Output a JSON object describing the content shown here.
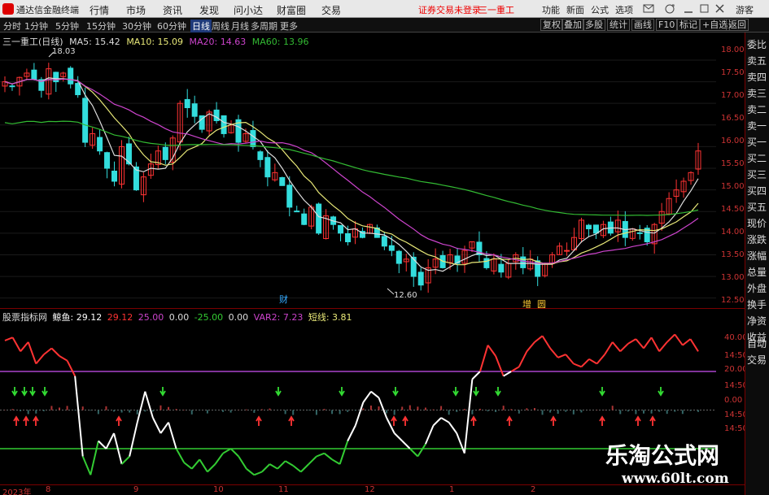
{
  "app": {
    "title": "通达信金融终端"
  },
  "menu": [
    "行情",
    "市场",
    "资讯",
    "发现",
    "问小达",
    "财富圈",
    "交易"
  ],
  "alert": "证券交易未登录",
  "stock": {
    "name": "三一重工"
  },
  "right_menu": [
    "功能",
    "新面",
    "公式",
    "选项"
  ],
  "guest": "游客",
  "tabs": [
    "分时",
    "1分钟",
    "5分钟",
    "15分钟",
    "30分钟",
    "60分钟",
    "日线",
    "周线",
    "月线",
    "多周期",
    "更多"
  ],
  "active_tab": "日线",
  "right_buttons": [
    "复权",
    "叠加",
    "多股",
    "统计",
    "画线",
    "F10",
    "标记",
    "+自选",
    "返回"
  ],
  "chart_header": {
    "label": "三一重工(日线)",
    "ma5": "MA5: 15.42",
    "ma10": "MA10: 15.09",
    "ma20": "MA20: 14.63",
    "ma60": "MA60: 13.96"
  },
  "indicator_header": {
    "name": "股票指标网",
    "jingyu": "鲸鱼: 29.12",
    "v1": "29.12",
    "v2": "25.00",
    "v3": "0.00",
    "v4": "-25.00",
    "v5": "0.00",
    "var2": "VAR2: 7.23",
    "short": "短线: 3.81"
  },
  "right_panel": [
    "委比",
    "卖五",
    "卖四",
    "卖三",
    "卖二",
    "卖一",
    "买一",
    "买二",
    "买三",
    "买四",
    "买五",
    "现价",
    "涨跌",
    "涨幅",
    "总量",
    "外盘",
    "换手",
    "净资",
    "收益"
  ],
  "right_panel_bottom": [
    "自动",
    "交易"
  ],
  "price_axis": [
    "18.00",
    "17.50",
    "17.00",
    "16.50",
    "16.00",
    "15.50",
    "15.00",
    "14.50",
    "14.00",
    "13.50",
    "13.00",
    "12.50"
  ],
  "indicator_axis": [
    "40.00",
    "14:50",
    "20.00",
    "14:50",
    "0.00",
    "14:50",
    "14:50"
  ],
  "date_axis": [
    "2023年",
    "8",
    "9",
    "10",
    "11",
    "12",
    "1",
    "2"
  ],
  "markers": {
    "high": "18.03",
    "low": "12.60"
  },
  "events": [
    "财",
    "增",
    "圆"
  ],
  "watermark": {
    "line1": "乐淘公式网",
    "line2": "www.60lt.com"
  },
  "colors": {
    "up": "#ff3333",
    "down": "#33dddd",
    "ma5": "#dddddd",
    "ma10": "#e8e878",
    "ma20": "#cc44cc",
    "ma60": "#33bb33",
    "line_high": "#ff3333",
    "line_low": "#33cc33",
    "line_mid": "#ffffff",
    "purple_ref": "#aa44cc"
  },
  "chart_data": [
    {
      "type": "candlestick",
      "title": "三一重工(日线)",
      "ylim": [
        12.4,
        18.3
      ],
      "approx_close": [
        17.5,
        17.4,
        17.6,
        17.7,
        17.55,
        17.3,
        17.8,
        17.5,
        17.7,
        17.45,
        17.2,
        16.1,
        16.3,
        15.9,
        15.5,
        15.2,
        16.0,
        15.6,
        15.0,
        15.3,
        15.6,
        15.9,
        15.7,
        16.2,
        17.0,
        16.9,
        16.7,
        16.4,
        16.8,
        16.6,
        16.3,
        16.5,
        16.1,
        16.3,
        16.0,
        15.7,
        15.3,
        15.4,
        15.1,
        14.6,
        14.5,
        14.2,
        14.6,
        14.0,
        14.4,
        14.2,
        14.0,
        13.8,
        14.1,
        13.9,
        14.2,
        13.9,
        13.7,
        13.6,
        13.3,
        13.4,
        13.0,
        12.8,
        13.2,
        13.4,
        13.2,
        13.5,
        13.3,
        13.6,
        13.8,
        13.5,
        13.2,
        13.4,
        13.1,
        13.3,
        13.5,
        13.2,
        13.4,
        13.0,
        13.3,
        13.5,
        13.7,
        13.6,
        13.9,
        14.3,
        14.1,
        14.0,
        14.2,
        14.0,
        14.3,
        13.9,
        14.1,
        14.0,
        13.8,
        14.2,
        14.5,
        14.8,
        15.0,
        15.2,
        15.4,
        15.9
      ]
    },
    {
      "type": "line",
      "title": "股票指标网",
      "ylim": [
        -45,
        55
      ],
      "series": [
        {
          "name": "鲸鱼",
          "values": [
            45,
            47,
            38,
            44,
            30,
            36,
            40,
            35,
            32,
            22,
            -30,
            -42,
            -20,
            -25,
            -15,
            -35,
            -30,
            -8,
            12,
            -5,
            -15,
            -8,
            -25,
            -34,
            -38,
            -32,
            -40,
            -35,
            -28,
            -25,
            -30,
            -38,
            -42,
            -40,
            -35,
            -38,
            -33,
            -36,
            -40,
            -35,
            -30,
            -28,
            -32,
            -35,
            -20,
            -10,
            5,
            12,
            8,
            -5,
            -15,
            -20,
            -25,
            -30,
            -22,
            -10,
            -5,
            -8,
            -15,
            -28,
            20,
            25,
            42,
            35,
            22,
            25,
            28,
            38,
            44,
            48,
            40,
            34,
            36,
            30,
            28,
            33,
            30,
            36,
            44,
            38,
            43,
            46,
            40,
            47,
            38,
            44,
            49,
            42,
            46,
            38
          ]
        }
      ]
    }
  ]
}
